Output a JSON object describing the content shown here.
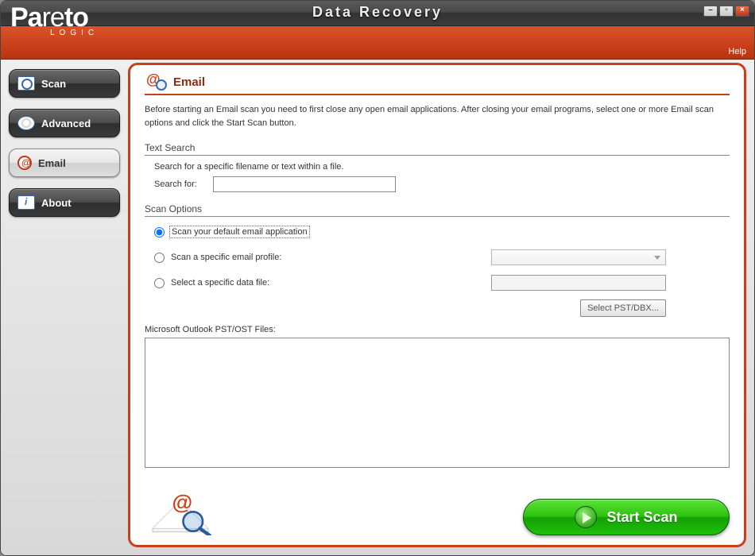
{
  "app": {
    "title": "Data Recovery",
    "help_label": "Help",
    "brand_main": "Pareto",
    "brand_sub": "LOGIC"
  },
  "window_controls": {
    "minimize": "–",
    "restore": "▫",
    "close": "×"
  },
  "sidebar": {
    "items": [
      {
        "label": "Scan",
        "name": "sidebar-item-scan",
        "icon": "scan"
      },
      {
        "label": "Advanced",
        "name": "sidebar-item-advanced",
        "icon": "disk"
      },
      {
        "label": "Email",
        "name": "sidebar-item-email",
        "icon": "email",
        "active": true
      },
      {
        "label": "About",
        "name": "sidebar-item-about",
        "icon": "about"
      }
    ]
  },
  "panel": {
    "title": "Email",
    "intro": "Before starting an Email scan you need to first close any open email applications. After closing your email programs, select one or more Email scan options and click the Start Scan button.",
    "text_search": {
      "heading": "Text Search",
      "subtext": "Search for a specific filename or text within a file.",
      "label": "Search for:",
      "value": ""
    },
    "scan_options": {
      "heading": "Scan Options",
      "options": [
        {
          "label": "Scan your default email application",
          "value": "default",
          "selected": true
        },
        {
          "label": "Scan a specific email profile:",
          "value": "profile",
          "selected": false
        },
        {
          "label": "Select a specific data file:",
          "value": "file",
          "selected": false
        }
      ],
      "profile_combo_value": "",
      "file_box_value": "",
      "select_file_button": "Select PST/DBX..."
    },
    "files_list": {
      "label": "Microsoft Outlook PST/OST Files:"
    },
    "start_button": "Start Scan"
  },
  "colors": {
    "accent_orange": "#c93f1a",
    "accent_green": "#1fbf0c",
    "title_dark": "#8a2a10"
  }
}
